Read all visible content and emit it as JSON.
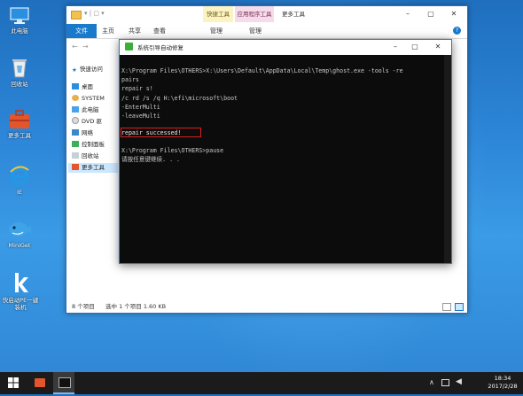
{
  "desktop": {
    "icons": [
      {
        "label": "此电脑",
        "icon": "computer-icon"
      },
      {
        "label": "回收站",
        "icon": "recycle-bin-icon"
      },
      {
        "label": "更多工具",
        "icon": "toolbox-icon"
      },
      {
        "label": "IE",
        "icon": "ie-icon"
      },
      {
        "label": "MiniGet",
        "icon": "miniget-icon"
      },
      {
        "label": "快启动PE一键装机",
        "icon": "kqd-icon"
      }
    ]
  },
  "explorer": {
    "context_tab_1": "快捷工具",
    "context_tab_2": "应用程序工具",
    "window_title": "更多工具",
    "tabs": [
      "文件",
      "主页",
      "共享",
      "查看",
      "管理",
      "管理"
    ],
    "nav": [
      "快速访问",
      "桌面",
      "SYSTEM",
      "此电脑",
      "DVD 驱",
      "网络",
      "控制面板",
      "回收站",
      "更多工具"
    ],
    "status_count": "8 个项目",
    "status_selected": "选中 1 个项目  1.60 KB"
  },
  "console": {
    "title": "系统引导自动修复",
    "lines": [
      "X:\\Program Files\\OTHERS>X:\\Users\\Default\\AppData\\Local\\Temp\\ghost.exe -tools -re",
      "pairs",
      "repair s!",
      "/c rd /s /q H:\\efi\\microsoft\\boot",
      "-EnterMulti",
      "-leaveMulti",
      "repair successed!",
      "",
      "X:\\Program Files\\OTHERS>pause",
      "请按任意键继续. . ."
    ]
  },
  "taskbar": {
    "time": "18:34",
    "date": "2017/2/28"
  },
  "colors": {
    "accent": "#1979ca",
    "highlight_box": "#e01e1e",
    "console_bg": "#0c0c0c"
  }
}
